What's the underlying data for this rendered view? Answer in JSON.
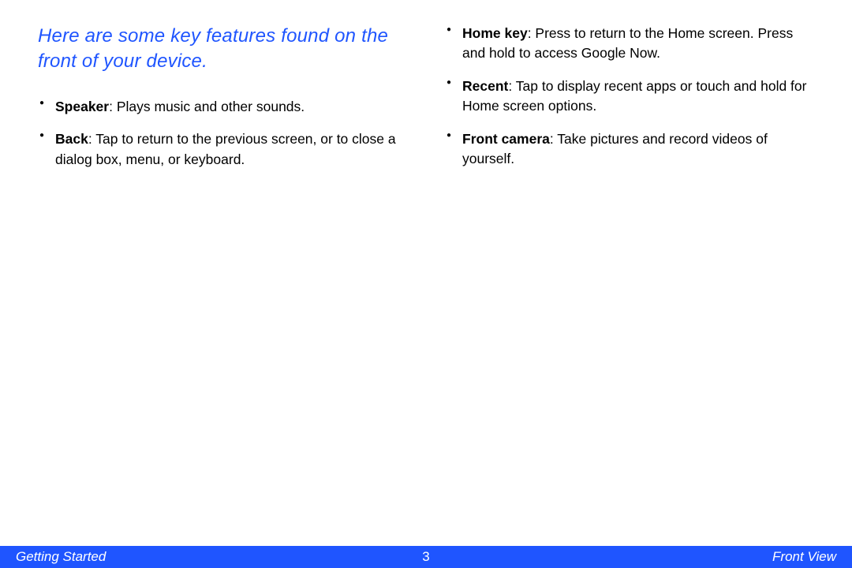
{
  "intro": "Here are some key features found on the front of your device.",
  "left_items": [
    {
      "term": "Speaker",
      "desc": ": Plays music and other sounds."
    },
    {
      "term": "Back",
      "desc": ": Tap to return to the previous screen, or to close a dialog box, menu, or keyboard."
    }
  ],
  "right_items": [
    {
      "term": "Home key",
      "desc": ": Press to return to the Home screen. Press and hold to access Google Now."
    },
    {
      "term": "Recent",
      "desc": ": Tap to display recent apps or touch and hold for Home screen options."
    },
    {
      "term": "Front camera",
      "desc": ": Take pictures and record videos of yourself."
    }
  ],
  "footer": {
    "left": "Getting Started",
    "page": "3",
    "right": "Front View"
  }
}
